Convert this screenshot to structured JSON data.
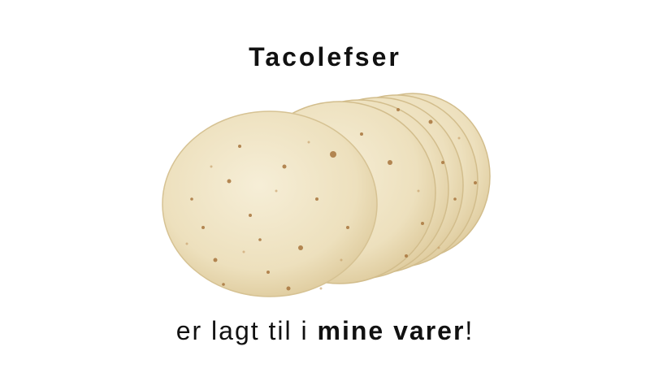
{
  "product": {
    "title": "Tacolefser",
    "image_icon": "tortilla-stack-icon"
  },
  "confirmation": {
    "prefix": "er lagt til i ",
    "link_text": "mine varer",
    "suffix": "!"
  },
  "colors": {
    "background": "#ffffff",
    "text": "#111111",
    "tortilla": "#efe4c6",
    "tortilla_edge": "#d9c79c",
    "spots": "#9b6a36"
  }
}
